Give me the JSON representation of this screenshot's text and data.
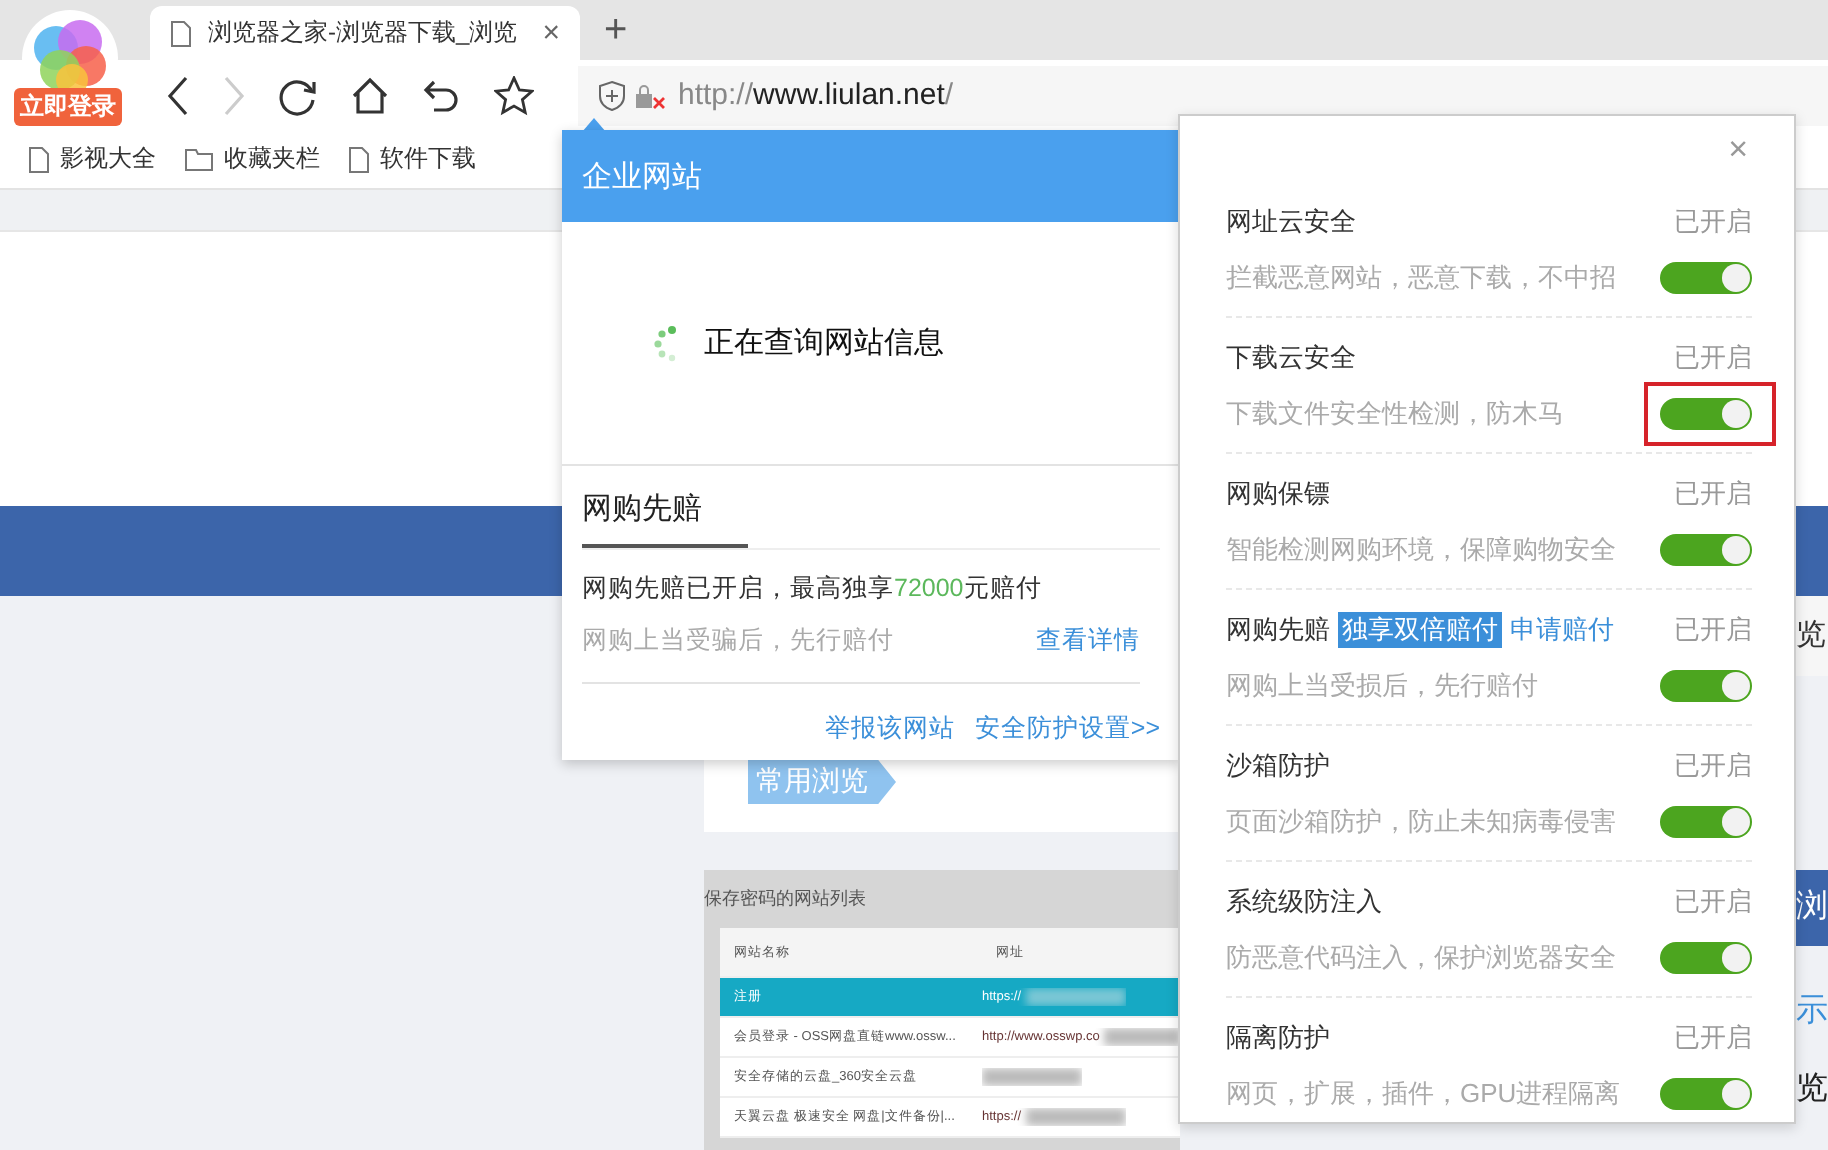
{
  "account": {
    "login_badge": "立即登录"
  },
  "tabs": [
    {
      "title": "浏览器之家-浏览器下载_浏览",
      "selected": true,
      "close": "×"
    }
  ],
  "new_tab": "+",
  "toolbar": {
    "back_enabled": true,
    "forward_enabled": false
  },
  "address": {
    "scheme": "http://",
    "host": "www.liulan.net",
    "path": "/"
  },
  "bookmarks": [
    {
      "kind": "page",
      "label": "影视大全"
    },
    {
      "kind": "folder",
      "label": "收藏夹栏"
    },
    {
      "kind": "page",
      "label": "软件下载"
    }
  ],
  "page": {
    "section_tag": "常用浏览",
    "edge_texts": [
      {
        "kind": "band",
        "text": "览"
      },
      {
        "kind": "block",
        "text": "浏"
      },
      {
        "kind": "link",
        "text": "示"
      },
      {
        "kind": "plain",
        "text": "览"
      }
    ],
    "screenshot": {
      "title": "保存密码的网站列表",
      "columns": [
        "网站名称",
        "网址"
      ],
      "rows": [
        {
          "name": "注册",
          "url": "https://",
          "selected": true
        },
        {
          "name": "会员登录 - OSS网盘直链www.ossw...",
          "url": "http://www.osswp.co",
          "selected": false
        },
        {
          "name": "安全存储的云盘_360安全云盘",
          "url": "",
          "selected": false
        },
        {
          "name": "天翼云盘 极速安全 网盘|文件备份|...",
          "url": "https://",
          "selected": false
        }
      ]
    }
  },
  "site_popup": {
    "title": "企业网站",
    "status": "正在查询网站信息",
    "section": "网购先赔",
    "guarantee": {
      "prefix": "网购先赔已开启，最高独享",
      "amount": "72000",
      "suffix": "元赔付"
    },
    "note": "网购上当受骗后，先行赔付",
    "details_link": "查看详情",
    "footer_links": [
      "举报该网站",
      "安全防护设置>>"
    ]
  },
  "security_panel": {
    "close": "×",
    "items": [
      {
        "title": "网址云安全",
        "status": "已开启",
        "description": "拦截恶意网站，恶意下载，不中招",
        "on": true,
        "highlighted": false
      },
      {
        "title": "下载云安全",
        "status": "已开启",
        "description": "下载文件安全性检测，防木马",
        "on": true,
        "highlighted": true
      },
      {
        "title": "网购保镖",
        "status": "已开启",
        "description": "智能检测网购环境，保障购物安全",
        "on": true,
        "highlighted": false
      },
      {
        "title": "网购先赔",
        "badge": "独享双倍赔付",
        "link": "申请赔付",
        "status": "已开启",
        "description": "网购上当受损后，先行赔付",
        "on": true,
        "highlighted": false
      },
      {
        "title": "沙箱防护",
        "status": "已开启",
        "description": "页面沙箱防护，防止未知病毒侵害",
        "on": true,
        "highlighted": false
      },
      {
        "title": "系统级防注入",
        "status": "已开启",
        "description": "防恶意代码注入，保护浏览器安全",
        "on": true,
        "highlighted": false
      },
      {
        "title": "隔离防护",
        "status": "已开启",
        "description": "网页，扩展，插件，GPU进程隔离",
        "on": true,
        "highlighted": false
      }
    ]
  }
}
